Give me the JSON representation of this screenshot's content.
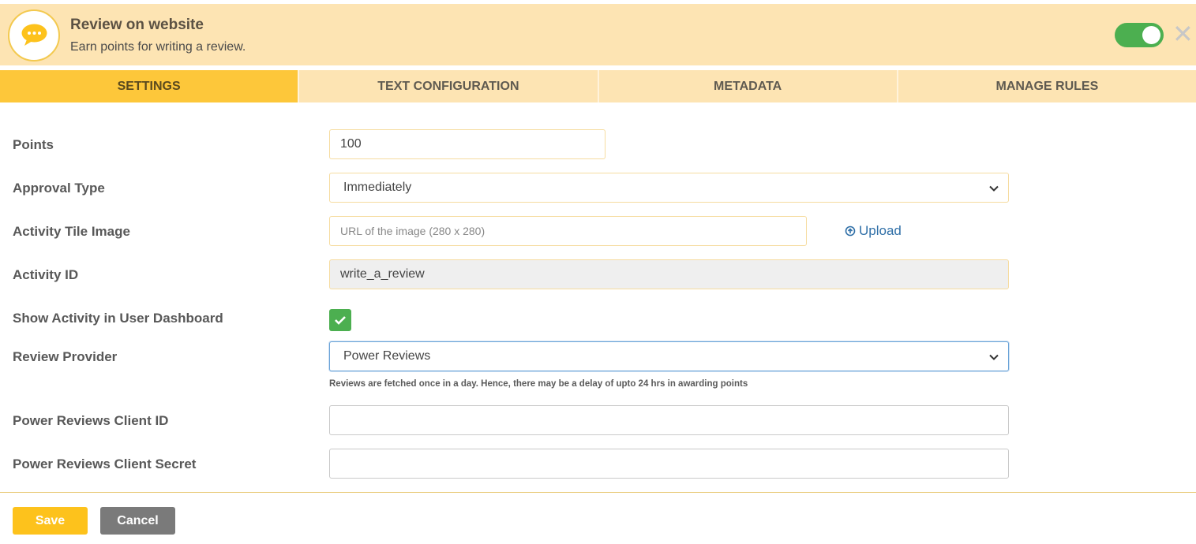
{
  "header": {
    "title": "Review on website",
    "subtitle": "Earn points for writing a review.",
    "icon": "chat-bubble-icon",
    "toggle_on": true
  },
  "tabs": [
    {
      "label": "SETTINGS",
      "active": true
    },
    {
      "label": "TEXT CONFIGURATION",
      "active": false
    },
    {
      "label": "METADATA",
      "active": false
    },
    {
      "label": "MANAGE RULES",
      "active": false
    }
  ],
  "form": {
    "points": {
      "label": "Points",
      "value": "100"
    },
    "approval_type": {
      "label": "Approval Type",
      "value": "Immediately"
    },
    "tile_image": {
      "label": "Activity Tile Image",
      "value": "",
      "placeholder": "URL of the image (280 x 280)",
      "upload_label": "Upload"
    },
    "activity_id": {
      "label": "Activity ID",
      "value": "write_a_review"
    },
    "show_in_dashboard": {
      "label": "Show Activity in User Dashboard",
      "checked": true
    },
    "review_provider": {
      "label": "Review Provider",
      "value": "Power Reviews",
      "hint": "Reviews are fetched once in a day. Hence, there may be a delay of upto 24 hrs in awarding points"
    },
    "client_id": {
      "label": "Power Reviews Client ID",
      "value": ""
    },
    "client_secret": {
      "label": "Power Reviews Client Secret",
      "value": ""
    }
  },
  "actions": {
    "save_label": "Save",
    "cancel_label": "Cancel"
  },
  "colors": {
    "header_bg": "#fde4b3",
    "active_tab": "#fdc73a",
    "toggle": "#4caf50",
    "save": "#fdc21c",
    "cancel": "#7a7a7a",
    "link": "#2f6fa7"
  }
}
